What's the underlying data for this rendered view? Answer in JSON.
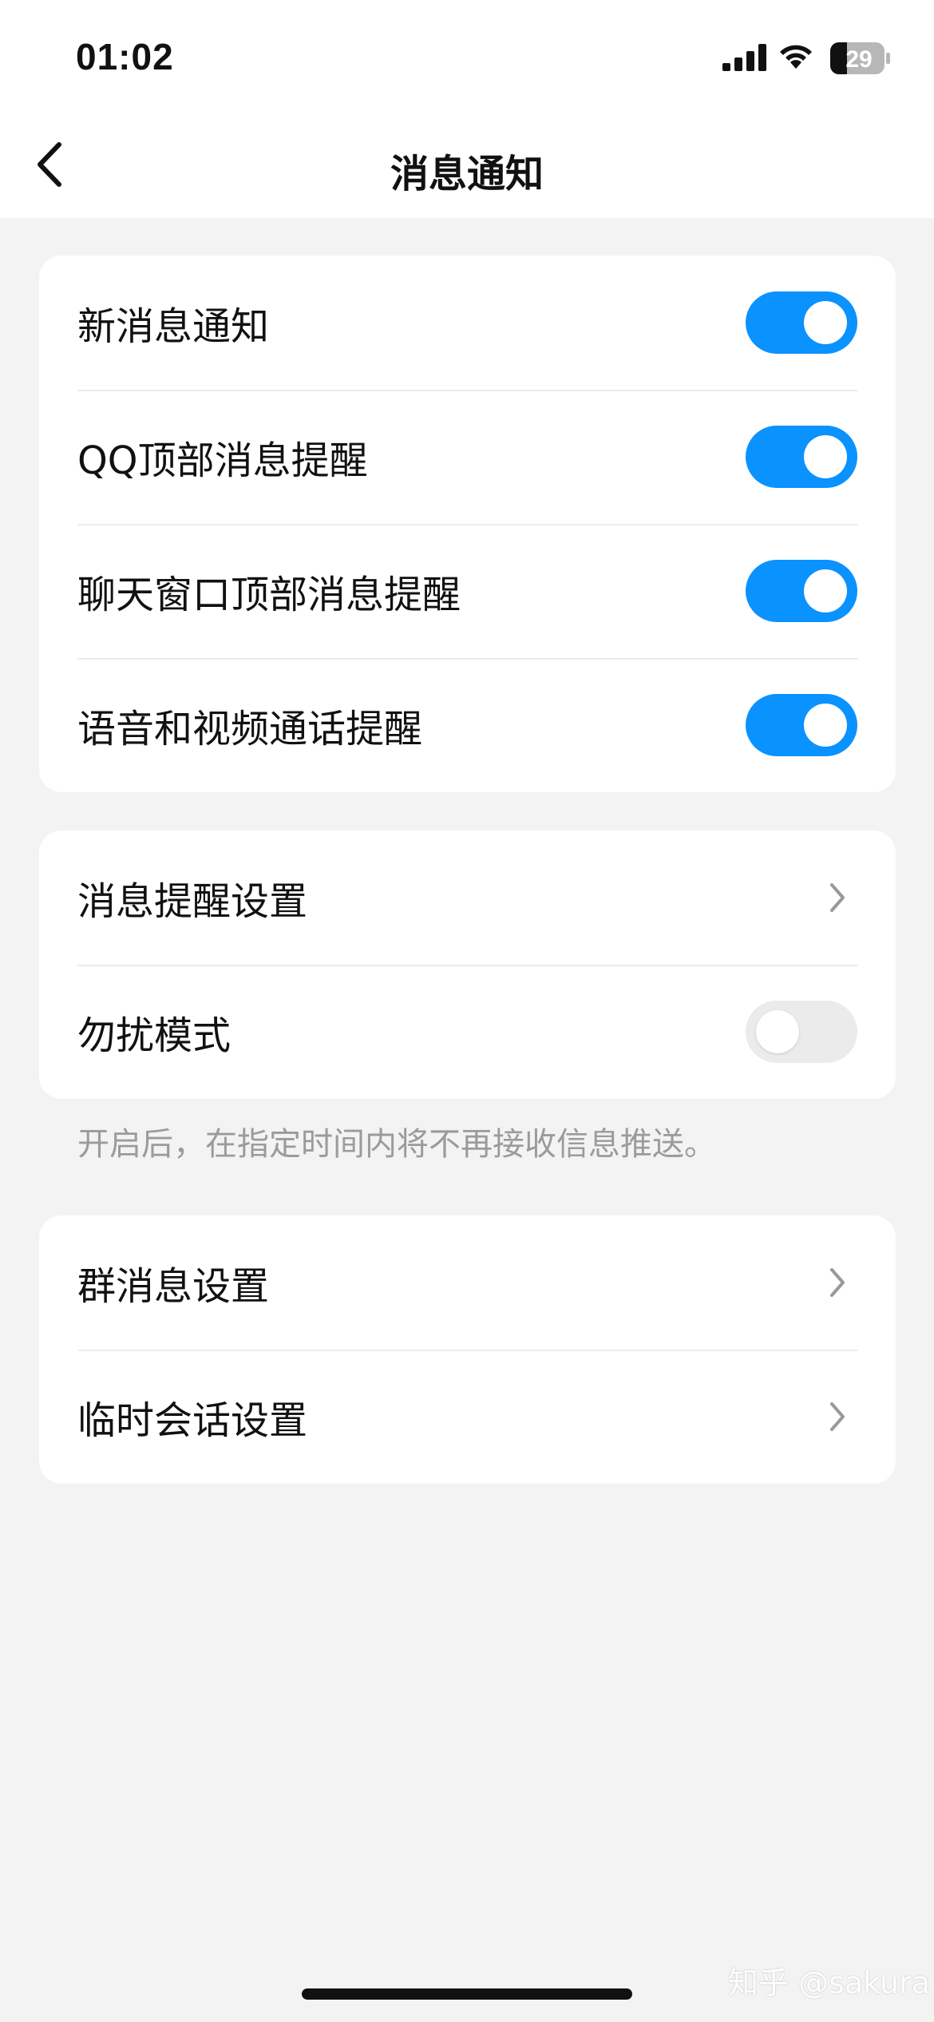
{
  "status_bar": {
    "time": "01:02",
    "battery": "29"
  },
  "nav": {
    "title": "消息通知"
  },
  "group1": {
    "items": [
      {
        "label": "新消息通知",
        "on": true
      },
      {
        "label": "QQ顶部消息提醒",
        "on": true
      },
      {
        "label": "聊天窗口顶部消息提醒",
        "on": true
      },
      {
        "label": "语音和视频通话提醒",
        "on": true
      }
    ]
  },
  "group2": {
    "items": [
      {
        "label": "消息提醒设置"
      },
      {
        "label": "勿扰模式",
        "on": false
      }
    ],
    "hint": "开启后，在指定时间内将不再接收信息推送。"
  },
  "group3": {
    "items": [
      {
        "label": "群消息设置"
      },
      {
        "label": "临时会话设置"
      }
    ]
  },
  "watermark": "知乎 @sakura",
  "colors": {
    "accent": "#0a92ff",
    "background": "#f3f3f3"
  }
}
